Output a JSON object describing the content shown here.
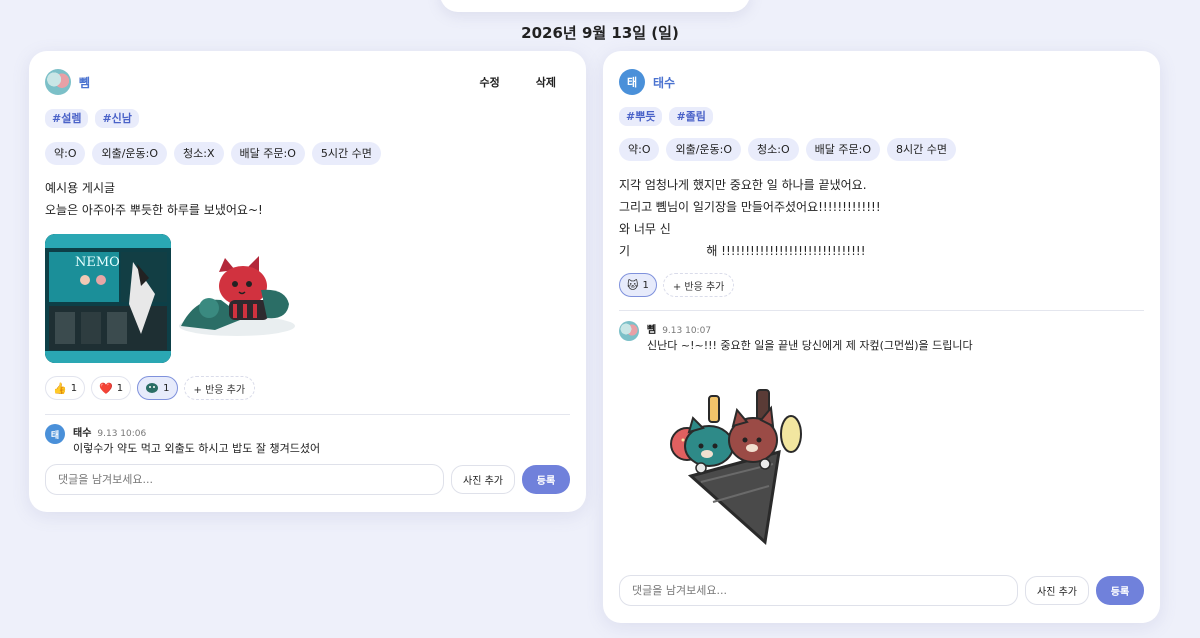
{
  "date_heading": "2026년 9월 13일 (일)",
  "post1": {
    "author": "뼴",
    "edit_label": "수정",
    "delete_label": "삭제",
    "hashtags": [
      "#설렘",
      "#신남"
    ],
    "chips": [
      "약:O",
      "외출/운동:O",
      "청소:X",
      "배달 주문:O",
      "5시간 수면"
    ],
    "body_line1": "예시용 게시글",
    "body_line2": "오늘은 아주아주 뿌듯한 하루를 보냈어요~!",
    "photo1_text": "NEMO",
    "reactions": [
      {
        "icon": "👍",
        "count": "1"
      },
      {
        "icon": "❤️",
        "count": "1"
      },
      {
        "icon": "",
        "count": "1"
      }
    ],
    "add_reaction_label": "+ 반응 추가",
    "comment": {
      "avatar_initial": "태",
      "author": "태수",
      "time": "9.13 10:06",
      "text": "이렇수가 약도 먹고 외출도 하시고 밥도 잘 챙겨드셨어"
    },
    "comment_placeholder": "댓글을 남겨보세요...",
    "photo_add_label": "사진 추가",
    "submit_label": "등록"
  },
  "post2": {
    "avatar_initial": "태",
    "author": "태수",
    "hashtags": [
      "#뿌듯",
      "#졸림"
    ],
    "chips": [
      "약:O",
      "외출/운동:O",
      "청소:O",
      "배달 주문:O",
      "8시간 수면"
    ],
    "body_line1": "지각 엄청나게 했지만 중요한 일 하나를 끝냈어요.",
    "body_line2": "그리고 뼴님이 일기장을 만들어주셨어요!!!!!!!!!!!!!",
    "body_line3": "와 너무 신",
    "body_line4": "기                    해 !!!!!!!!!!!!!!!!!!!!!!!!!!!!!!",
    "reactions": [
      {
        "icon": "🐱",
        "count": "1"
      }
    ],
    "add_reaction_label": "+ 반응 추가",
    "comment": {
      "author": "뼴",
      "time": "9.13 10:07",
      "text": "신난다 ~!~!!! 중요한 일을 끝낸 당신에게 제 자컾(그먼씹)을 드립니다"
    },
    "comment_placeholder": "댓글을 남겨보세요...",
    "photo_add_label": "사진 추가",
    "submit_label": "등록"
  },
  "colors": {
    "background": "#eef0fa",
    "accent": "#7081db",
    "author_link": "#4a72d0",
    "chip_bg": "#e9ecfb"
  }
}
